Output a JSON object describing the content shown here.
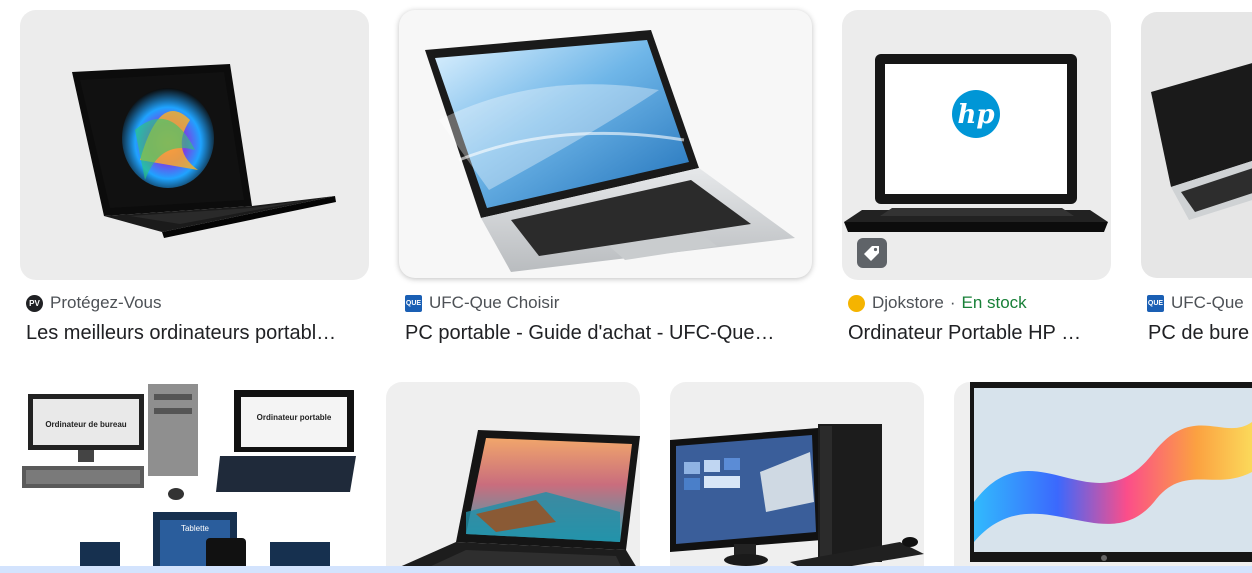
{
  "results": [
    {
      "source": "Protégez-Vous",
      "title": "Les meilleurs ordinateurs portabl…",
      "favicon_text": "PV",
      "favicon": "protegez-vous-favicon"
    },
    {
      "source": "UFC-Que Choisir",
      "title": "PC portable - Guide d'achat - UFC-Que…",
      "favicon_text": "QUE",
      "favicon": "ufc-que-choisir-favicon"
    },
    {
      "source": "Djokstore",
      "stock": "En stock",
      "title": "Ordinateur Portable HP …",
      "favicon": "djokstore-favicon",
      "badge": "shopping-tag-icon"
    },
    {
      "source": "UFC-Que",
      "title": "PC de bure",
      "favicon_text": "QUE",
      "favicon": "ufc-que-choisir-favicon"
    }
  ],
  "images": {
    "row2_card1": {
      "label_bureau": "Ordinateur de bureau",
      "label_portable": "Ordinateur portable",
      "label_tablette": "Tablette"
    }
  },
  "colors": {
    "stock": "#188038",
    "source_text": "#4d5156",
    "title_text": "#202124",
    "accent_bar": "#d3e3fd"
  }
}
